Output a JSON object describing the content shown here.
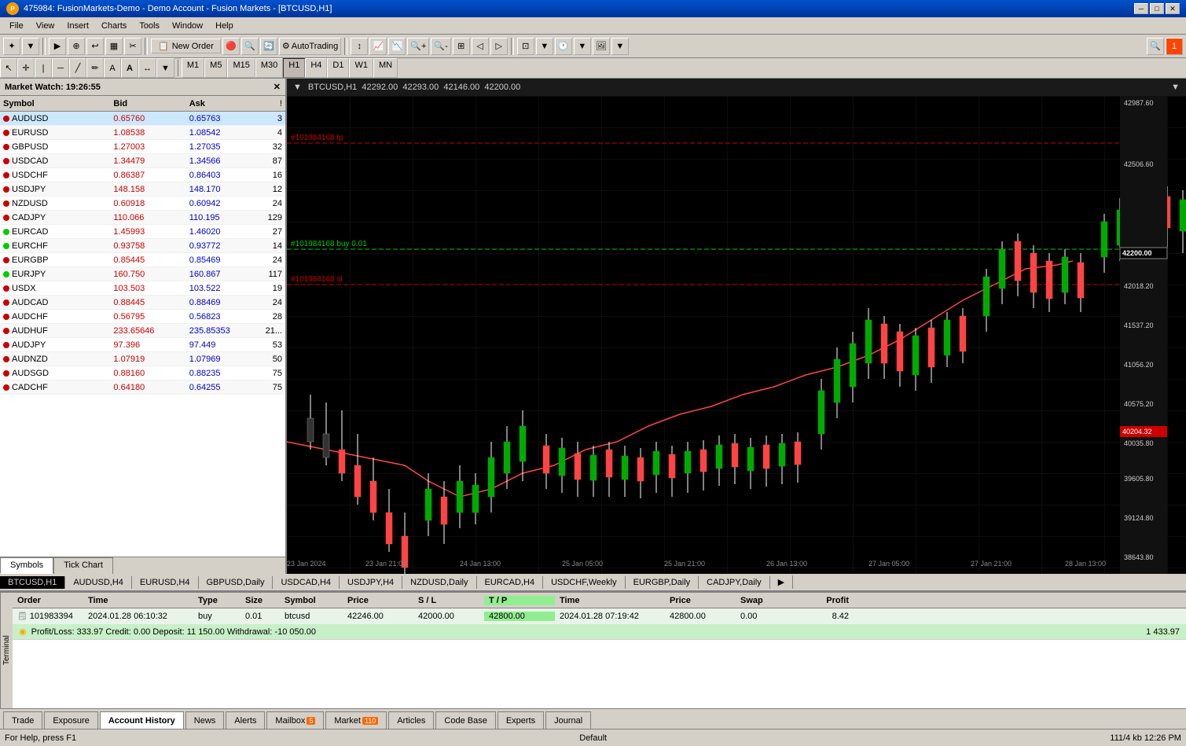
{
  "titleBar": {
    "title": "475984: FusionMarkets-Demo - Demo Account - Fusion Markets - [BTCUSD,H1]",
    "icon": "P",
    "controls": [
      "minimize",
      "maximize",
      "close"
    ]
  },
  "menuBar": {
    "items": [
      "File",
      "View",
      "Insert",
      "Charts",
      "Tools",
      "Window",
      "Help"
    ]
  },
  "toolbar": {
    "newOrderLabel": "New Order",
    "autoTradingLabel": "AutoTrading"
  },
  "timeframes": {
    "items": [
      "M1",
      "M5",
      "M15",
      "M30",
      "H1",
      "H4",
      "D1",
      "W1",
      "MN"
    ],
    "active": "H1"
  },
  "marketWatch": {
    "title": "Market Watch: 19:26:55",
    "columns": {
      "symbol": "Symbol",
      "bid": "Bid",
      "ask": "Ask",
      "spread": "!"
    },
    "rows": [
      {
        "symbol": "AUDUSD",
        "bid": "0.65760",
        "ask": "0.65763",
        "spread": "3",
        "color": "red"
      },
      {
        "symbol": "EURUSD",
        "bid": "1.08538",
        "ask": "1.08542",
        "spread": "4",
        "color": "red"
      },
      {
        "symbol": "GBPUSD",
        "bid": "1.27003",
        "ask": "1.27035",
        "spread": "32",
        "color": "red"
      },
      {
        "symbol": "USDCAD",
        "bid": "1.34479",
        "ask": "1.34566",
        "spread": "87",
        "color": "red"
      },
      {
        "symbol": "USDCHF",
        "bid": "0.86387",
        "ask": "0.86403",
        "spread": "16",
        "color": "red"
      },
      {
        "symbol": "USDJPY",
        "bid": "148.158",
        "ask": "148.170",
        "spread": "12",
        "color": "red"
      },
      {
        "symbol": "NZDUSD",
        "bid": "0.60918",
        "ask": "0.60942",
        "spread": "24",
        "color": "red"
      },
      {
        "symbol": "CADJPY",
        "bid": "110.066",
        "ask": "110.195",
        "spread": "129",
        "color": "red"
      },
      {
        "symbol": "EURCAD",
        "bid": "1.45993",
        "ask": "1.46020",
        "spread": "27",
        "color": "green"
      },
      {
        "symbol": "EURCHF",
        "bid": "0.93758",
        "ask": "0.93772",
        "spread": "14",
        "color": "green"
      },
      {
        "symbol": "EURGBP",
        "bid": "0.85445",
        "ask": "0.85469",
        "spread": "24",
        "color": "red"
      },
      {
        "symbol": "EURJPY",
        "bid": "160.750",
        "ask": "160.867",
        "spread": "117",
        "color": "green"
      },
      {
        "symbol": "USDX",
        "bid": "103.503",
        "ask": "103.522",
        "spread": "19",
        "color": "red"
      },
      {
        "symbol": "AUDCAD",
        "bid": "0.88445",
        "ask": "0.88469",
        "spread": "24",
        "color": "red"
      },
      {
        "symbol": "AUDCHF",
        "bid": "0.56795",
        "ask": "0.56823",
        "spread": "28",
        "color": "red"
      },
      {
        "symbol": "AUDHUF",
        "bid": "233.65646",
        "ask": "235.85353",
        "spread": "21...",
        "color": "red"
      },
      {
        "symbol": "AUDJPY",
        "bid": "97.396",
        "ask": "97.449",
        "spread": "53",
        "color": "red"
      },
      {
        "symbol": "AUDNZD",
        "bid": "1.07919",
        "ask": "1.07969",
        "spread": "50",
        "color": "red"
      },
      {
        "symbol": "AUDSGD",
        "bid": "0.88160",
        "ask": "0.88235",
        "spread": "75",
        "color": "red"
      },
      {
        "symbol": "CADCHF",
        "bid": "0.64180",
        "ask": "0.64255",
        "spread": "75",
        "color": "red"
      }
    ],
    "tabs": [
      {
        "label": "Symbols",
        "active": true
      },
      {
        "label": "Tick Chart",
        "active": false
      }
    ]
  },
  "chart": {
    "symbol": "BTCUSD,H1",
    "bid": "42292.00",
    "ask": "42293.00",
    "high": "42146.00",
    "close": "42200.00",
    "priceLines": {
      "tp": "#101984168 tp",
      "buy": "#101984168 buy 0.01",
      "sl": "#101984168 sl"
    },
    "priceAxis": {
      "max": "42987.60",
      "levels": [
        "42506.60",
        "42200.00",
        "42018.20",
        "41537.20",
        "41056.20",
        "40575.20",
        "40204.32",
        "40035.80",
        "39605.80",
        "39124.80",
        "38643.80"
      ]
    },
    "dateAxis": [
      "23 Jan 2024",
      "23 Jan 21:00",
      "24 Jan 13:00",
      "25 Jan 05:00",
      "25 Jan 21:00",
      "26 Jan 13:00",
      "27 Jan 05:00",
      "27 Jan 21:00",
      "28 Jan 13:00"
    ]
  },
  "symbolTabs": [
    "AUDUSD,H4",
    "EURUSD,H4",
    "GBPUSD,Daily",
    "USDCAD,H4",
    "USDJPY,H4",
    "NZDUSD,Daily",
    "EURCAD,H4",
    "USDCHF,Weekly",
    "EURGBP,Daily",
    "CADJPY,Daily"
  ],
  "terminal": {
    "table": {
      "columns": [
        "Order",
        "Time",
        "Type",
        "Size",
        "Symbol",
        "Price",
        "S / L",
        "T / P",
        "Time",
        "Price",
        "Swap",
        "Profit"
      ],
      "rows": [
        {
          "order": "101983394",
          "time": "2024.01.28 06:10:32",
          "type": "buy",
          "size": "0.01",
          "symbol": "btcusd",
          "price": "42246.00",
          "sl": "42000.00",
          "tp": "42800.00",
          "time2": "2024.01.28 07:19:42",
          "price2": "42800.00",
          "swap": "0.00",
          "profit": "8.42"
        }
      ]
    },
    "summary": "Profit/Loss: 333.97  Credit: 0.00  Deposit: 11 150.00  Withdrawal: -10 050.00",
    "totalProfit": "1 433.97",
    "tabs": [
      {
        "label": "Trade",
        "active": false
      },
      {
        "label": "Exposure",
        "active": false
      },
      {
        "label": "Account History",
        "active": true
      },
      {
        "label": "News",
        "active": false
      },
      {
        "label": "Alerts",
        "active": false
      },
      {
        "label": "Mailbox",
        "active": false,
        "badge": "5"
      },
      {
        "label": "Market",
        "active": false,
        "badge": "110"
      },
      {
        "label": "Articles",
        "active": false
      },
      {
        "label": "Code Base",
        "active": false
      },
      {
        "label": "Experts",
        "active": false
      },
      {
        "label": "Journal",
        "active": false
      }
    ]
  },
  "statusBar": {
    "left": "For Help, press F1",
    "middle": "Default",
    "right": "111/4 kb  12:26 PM"
  }
}
